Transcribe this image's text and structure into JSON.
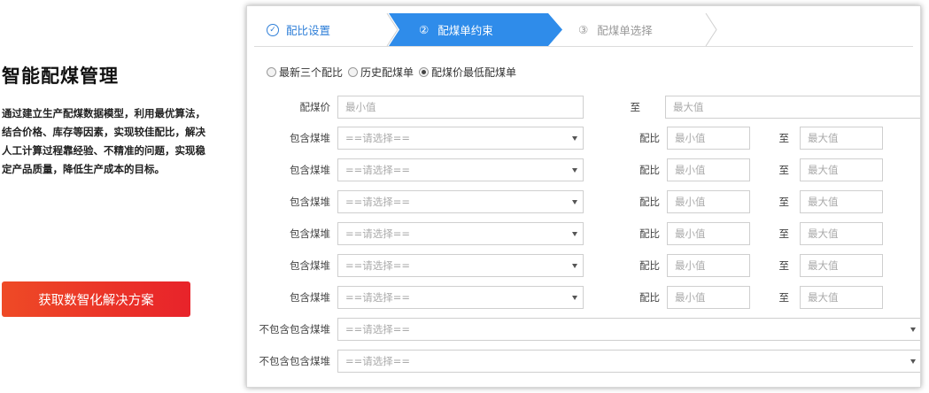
{
  "intro": {
    "title": "智能配煤管理",
    "description": "通过建立生产配煤数据模型，利用最优算法，结合价格、库存等因素，实现较佳配比，解决人工计算过程靠经验、不精准的问题，实现稳定产品质量，降低生产成本的目标。",
    "cta_label": "获取数智化解决方案"
  },
  "steps": [
    {
      "label": "配比设置",
      "icon": "check-circle-icon",
      "state": "done"
    },
    {
      "number": "②",
      "label": "配煤单约束",
      "state": "active"
    },
    {
      "number": "③",
      "label": "配煤单选择",
      "state": "pending"
    }
  ],
  "radios": [
    {
      "label": "最新三个配比",
      "checked": false
    },
    {
      "label": "历史配煤单",
      "checked": false
    },
    {
      "label": "配煤价最低配煤单",
      "checked": true
    }
  ],
  "price": {
    "label": "配煤价",
    "min_placeholder": "最小值",
    "to_label": "至",
    "max_placeholder": "最大值"
  },
  "include_rows": [
    {
      "label": "包含煤堆",
      "select": "==请选择==",
      "ratio_label": "配比",
      "min_placeholder": "最小值",
      "to_label": "至",
      "max_placeholder": "最大值"
    },
    {
      "label": "包含煤堆",
      "select": "==请选择==",
      "ratio_label": "配比",
      "min_placeholder": "最小值",
      "to_label": "至",
      "max_placeholder": "最大值"
    },
    {
      "label": "包含煤堆",
      "select": "==请选择==",
      "ratio_label": "配比",
      "min_placeholder": "最小值",
      "to_label": "至",
      "max_placeholder": "最大值"
    },
    {
      "label": "包含煤堆",
      "select": "==请选择==",
      "ratio_label": "配比",
      "min_placeholder": "最小值",
      "to_label": "至",
      "max_placeholder": "最大值"
    },
    {
      "label": "包含煤堆",
      "select": "==请选择==",
      "ratio_label": "配比",
      "min_placeholder": "最小值",
      "to_label": "至",
      "max_placeholder": "最大值"
    },
    {
      "label": "包含煤堆",
      "select": "==请选择==",
      "ratio_label": "配比",
      "min_placeholder": "最小值",
      "to_label": "至",
      "max_placeholder": "最大值"
    }
  ],
  "exclude_rows": [
    {
      "label": "不包含包含煤堆",
      "select": "==请选择=="
    },
    {
      "label": "不包含包含煤堆",
      "select": "==请选择=="
    }
  ],
  "colors": {
    "accent": "#2f8cea",
    "cta": "#e8232a"
  }
}
